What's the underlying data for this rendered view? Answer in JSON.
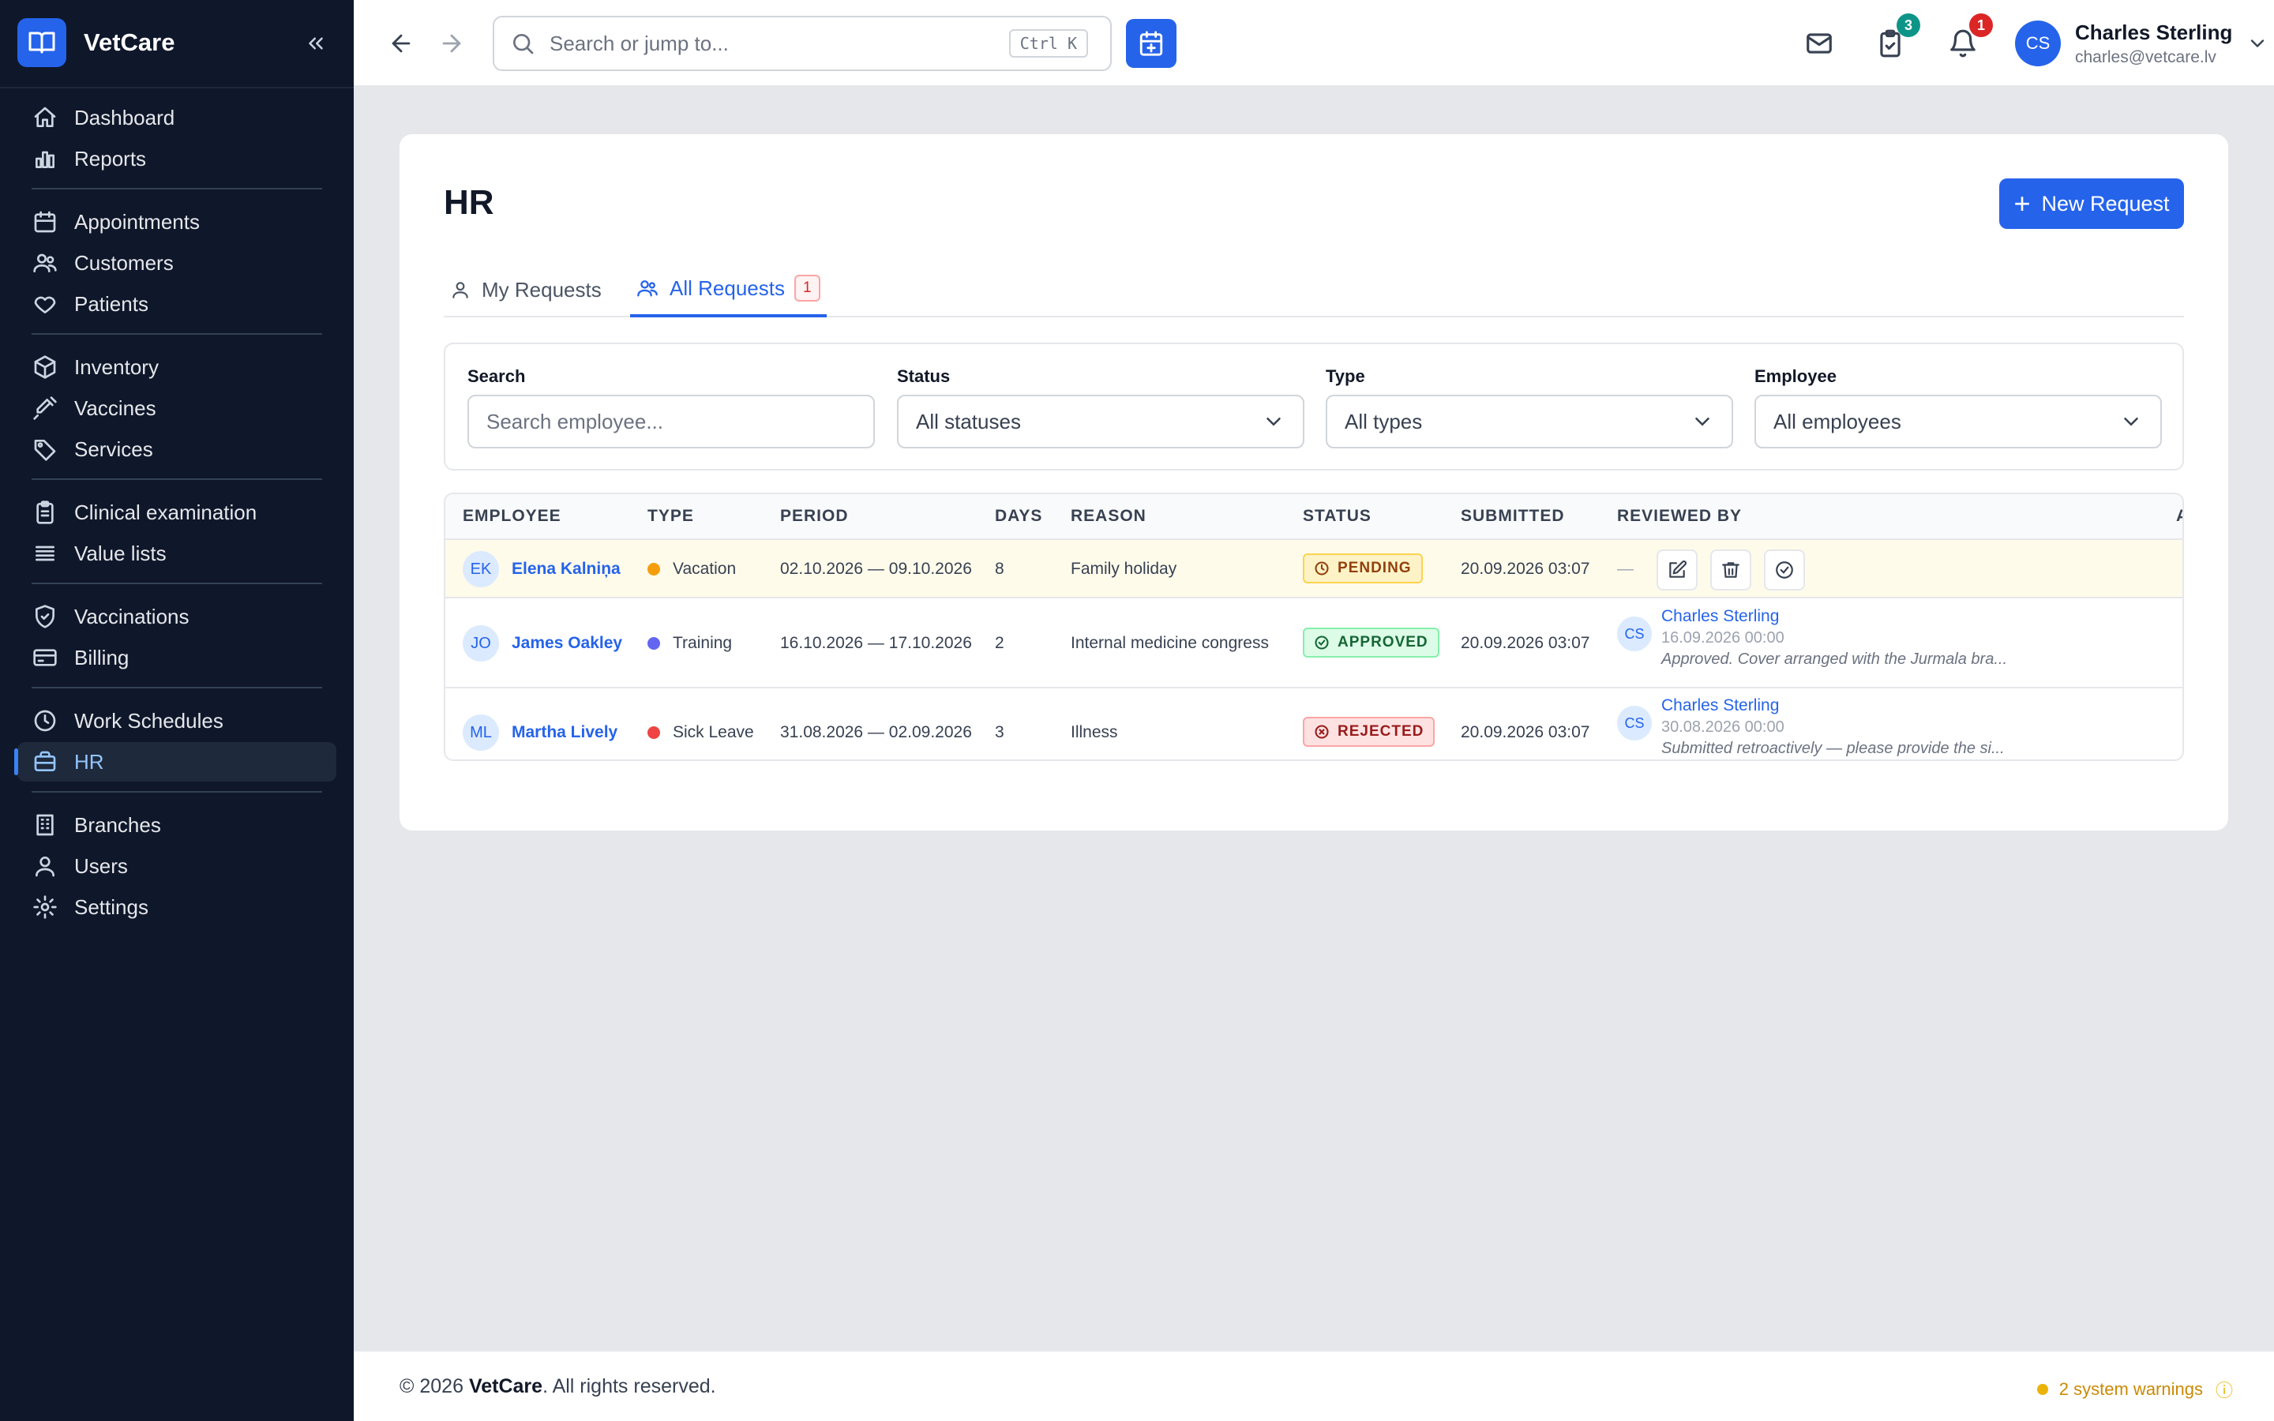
{
  "app": {
    "name": "VetCare"
  },
  "sidebar": {
    "groups": [
      [
        {
          "label": "Dashboard",
          "icon": "home-icon"
        },
        {
          "label": "Reports",
          "icon": "bar-chart-icon"
        }
      ],
      [
        {
          "label": "Appointments",
          "icon": "calendar-icon"
        },
        {
          "label": "Customers",
          "icon": "users-icon"
        },
        {
          "label": "Patients",
          "icon": "heart-icon"
        }
      ],
      [
        {
          "label": "Inventory",
          "icon": "box-icon"
        },
        {
          "label": "Vaccines",
          "icon": "syringe-icon"
        },
        {
          "label": "Services",
          "icon": "tag-icon"
        }
      ],
      [
        {
          "label": "Clinical examination",
          "icon": "clipboard-icon"
        },
        {
          "label": "Value lists",
          "icon": "list-icon"
        }
      ],
      [
        {
          "label": "Vaccinations",
          "icon": "shield-check-icon"
        },
        {
          "label": "Billing",
          "icon": "credit-card-icon"
        }
      ],
      [
        {
          "label": "Work Schedules",
          "icon": "clock-icon"
        },
        {
          "label": "HR",
          "icon": "briefcase-icon",
          "active": true
        }
      ],
      [
        {
          "label": "Branches",
          "icon": "building-icon"
        },
        {
          "label": "Users",
          "icon": "user-icon"
        },
        {
          "label": "Settings",
          "icon": "gear-icon"
        }
      ]
    ]
  },
  "topbar": {
    "search_placeholder": "Search or jump to...",
    "search_shortcut": "Ctrl K",
    "tasks_count": "3",
    "notifications_count": "1",
    "user": {
      "initials": "CS",
      "name": "Charles Sterling",
      "email": "charles@vetcare.lv"
    }
  },
  "page": {
    "title": "HR",
    "new_button": "New Request",
    "tabs": [
      {
        "label": "My Requests"
      },
      {
        "label": "All Requests",
        "badge": "1"
      }
    ],
    "filters": {
      "search": {
        "label": "Search",
        "placeholder": "Search employee..."
      },
      "status": {
        "label": "Status",
        "value": "All statuses"
      },
      "type": {
        "label": "Type",
        "value": "All types"
      },
      "employee": {
        "label": "Employee",
        "value": "All employees"
      }
    },
    "table": {
      "columns": [
        "EMPLOYEE",
        "TYPE",
        "PERIOD",
        "DAYS",
        "REASON",
        "STATUS",
        "SUBMITTED",
        "REVIEWED BY",
        "A"
      ],
      "rows": [
        {
          "initials": "EK",
          "employee": "Elena Kalniņa",
          "type": "Vacation",
          "type_color": "#f59e0b",
          "period": "02.10.2026 — 09.10.2026",
          "days": "8",
          "reason": "Family holiday",
          "status": "PENDING",
          "submitted": "20.09.2026 03:07",
          "reviewer_empty": "—"
        },
        {
          "initials": "JO",
          "employee": "James Oakley",
          "type": "Training",
          "type_color": "#6366f1",
          "period": "16.10.2026 — 17.10.2026",
          "days": "2",
          "reason": "Internal medicine congress",
          "status": "APPROVED",
          "submitted": "20.09.2026 03:07",
          "reviewer_initials": "CS",
          "reviewer": "Charles Sterling",
          "reviewed_at": "16.09.2026 00:00",
          "review_note": "Approved. Cover arranged with the Jurmala bra..."
        },
        {
          "initials": "ML",
          "employee": "Martha Lively",
          "type": "Sick Leave",
          "type_color": "#ef4444",
          "period": "31.08.2026 — 02.09.2026",
          "days": "3",
          "reason": "Illness",
          "status": "REJECTED",
          "submitted": "20.09.2026 03:07",
          "reviewer_initials": "CS",
          "reviewer": "Charles Sterling",
          "reviewed_at": "30.08.2026 00:00",
          "review_note": "Submitted retroactively — please provide the si..."
        }
      ]
    }
  },
  "footer": {
    "copyright_prefix": "© 2026",
    "brand": "VetCare",
    "copyright_suffix": ". All rights reserved.",
    "warnings": "2 system warnings"
  },
  "colors": {
    "accent": "#2563eb",
    "sidebar_bg": "#0f172a",
    "pending": "#f59e0b",
    "approved": "#16a34a",
    "rejected": "#dc2626"
  }
}
